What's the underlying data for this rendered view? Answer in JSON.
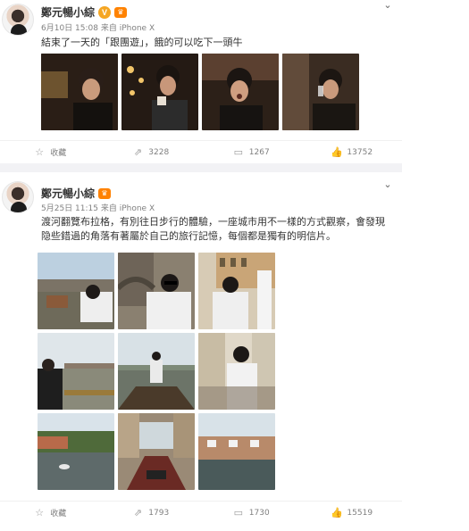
{
  "posts": [
    {
      "author": "鄭元暢小綜",
      "meta": "6月10日 15:08 来自 iPhone X",
      "text": "結束了一天的「跟團遊」，餓的可以吃下一頭牛",
      "actions": {
        "favorite": "收藏",
        "repost": "3228",
        "comment": "1267",
        "like": "13752"
      }
    },
    {
      "author": "鄭元暢小綜",
      "meta": "5月25日 11:15 来自 iPhone X",
      "text": "渡河翻覽布拉格，有別往日步行的體驗，一座城市用不一樣的方式觀察，會發現隐些錯過的角落有著屬於自己的旅行記憶，每個都是獨有的明信片。",
      "actions": {
        "favorite": "收藏",
        "repost": "1793",
        "comment": "1730",
        "like": "15519"
      }
    }
  ],
  "colors": {
    "text": "#333333",
    "meta": "#808080",
    "verified": "#f5a623",
    "separator": "#f2f2f5"
  },
  "icons": {
    "verified": "verified-v-icon",
    "member": "member-crown-icon",
    "menu": "chevron-down-icon",
    "favorite": "star-icon",
    "repost": "repost-icon",
    "comment": "comment-icon",
    "like": "thumbs-up-icon"
  }
}
